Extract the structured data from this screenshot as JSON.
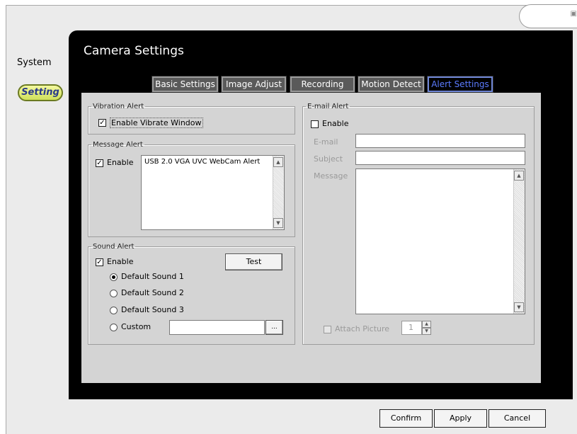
{
  "sidebar": {
    "section_title": "System",
    "active_item": "Setting"
  },
  "panel": {
    "title": "Camera Settings"
  },
  "tabs": [
    {
      "label": "Basic Settings"
    },
    {
      "label": "Image Adjust"
    },
    {
      "label": "Recording"
    },
    {
      "label": "Motion Detect"
    },
    {
      "label": "Alert Settings",
      "active": true
    }
  ],
  "vibration": {
    "legend": "Vibration Alert",
    "enable_label": "Enable Vibrate Window",
    "checked": true
  },
  "message": {
    "legend": "Message Alert",
    "enable_label": "Enable",
    "checked": true,
    "text": "USB 2.0 VGA UVC WebCam Alert"
  },
  "sound": {
    "legend": "Sound Alert",
    "enable_label": "Enable",
    "checked": true,
    "test_label": "Test",
    "options": [
      "Default Sound 1",
      "Default Sound 2",
      "Default Sound 3",
      "Custom"
    ],
    "selected": "Default Sound 1",
    "browse_label": "..."
  },
  "email": {
    "legend": "E-mail Alert",
    "enable_label": "Enable",
    "checked": false,
    "email_label": "E-mail",
    "subject_label": "Subject",
    "message_label": "Message",
    "attach_label": "Attach Picture",
    "attach_count": "1"
  },
  "footer": {
    "confirm": "Confirm",
    "apply": "Apply",
    "cancel": "Cancel"
  },
  "colors": {
    "active_tab_text": "#5b7bff",
    "setting_pill": "#cfe05a"
  }
}
